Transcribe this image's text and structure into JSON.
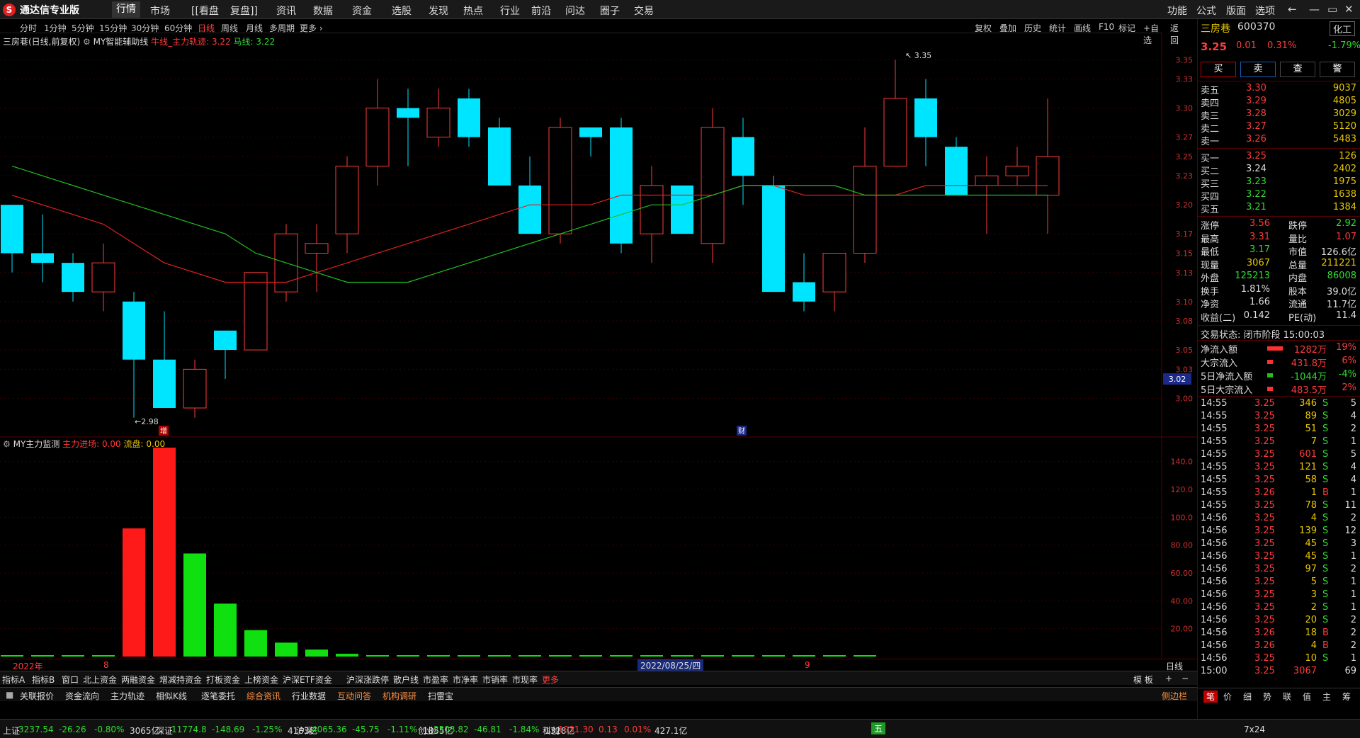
{
  "app": {
    "name": "通达信专业版"
  },
  "topmenu": [
    "行情",
    "市场",
    "[[看盘",
    "复盘]]",
    "资讯",
    "数据",
    "资金",
    "选股",
    "发现",
    "热点",
    "行业",
    "前沿",
    "问达",
    "圈子",
    "交易"
  ],
  "topmenu_right": [
    "功能",
    "公式",
    "版面",
    "选项"
  ],
  "periods": [
    "分时",
    "1分钟",
    "5分钟",
    "15分钟",
    "30分钟",
    "60分钟",
    "日线",
    "周线",
    "月线",
    "多周期",
    "更多 ›"
  ],
  "tools": [
    "复权",
    "叠加",
    "历史",
    "统计",
    "画线",
    "F10",
    "标记",
    "+自选",
    "返回"
  ],
  "main_title": {
    "stock": "三房巷(日线,前复权)",
    "indicator": "MY智能辅助线",
    "l1": "牛线_主力轨迹: 3.22",
    "l2": "马线: 3.22"
  },
  "sub_title": {
    "name": "MY主力监测",
    "l1": "主力进场: 0.00",
    "l2": "流盘: 0.00"
  },
  "price_axis": [
    "3.35",
    "3.33",
    "3.30",
    "3.27",
    "3.25",
    "3.23",
    "3.20",
    "3.17",
    "3.15",
    "3.13",
    "3.10",
    "3.08",
    "3.05",
    "3.03",
    "3.00"
  ],
  "price_marker": "3.02",
  "sub_axis": [
    "140.0",
    "120.0",
    "100.0",
    "80.00",
    "60.00",
    "40.00",
    "20.00"
  ],
  "annotations": {
    "high": "3.35",
    "low": "2.98",
    "zeng": "增",
    "cai": "财"
  },
  "chart_data": {
    "type": "candlestick",
    "candles": [
      {
        "o": 3.2,
        "h": 3.2,
        "l": 3.13,
        "c": 3.15
      },
      {
        "o": 3.15,
        "h": 3.19,
        "l": 3.12,
        "c": 3.14
      },
      {
        "o": 3.14,
        "h": 3.15,
        "l": 3.1,
        "c": 3.11
      },
      {
        "o": 3.11,
        "h": 3.16,
        "l": 3.09,
        "c": 3.14
      },
      {
        "o": 3.1,
        "h": 3.11,
        "l": 2.98,
        "c": 3.04
      },
      {
        "o": 3.04,
        "h": 3.09,
        "l": 2.99,
        "c": 2.99
      },
      {
        "o": 2.99,
        "h": 3.04,
        "l": 2.98,
        "c": 3.03
      },
      {
        "o": 3.07,
        "h": 3.07,
        "l": 3.02,
        "c": 3.05
      },
      {
        "o": 3.05,
        "h": 3.13,
        "l": 3.05,
        "c": 3.13
      },
      {
        "o": 3.11,
        "h": 3.18,
        "l": 3.1,
        "c": 3.17
      },
      {
        "o": 3.15,
        "h": 3.18,
        "l": 3.11,
        "c": 3.16
      },
      {
        "o": 3.17,
        "h": 3.25,
        "l": 3.15,
        "c": 3.24
      },
      {
        "o": 3.24,
        "h": 3.33,
        "l": 3.22,
        "c": 3.3
      },
      {
        "o": 3.3,
        "h": 3.32,
        "l": 3.24,
        "c": 3.29
      },
      {
        "o": 3.27,
        "h": 3.32,
        "l": 3.26,
        "c": 3.3
      },
      {
        "o": 3.31,
        "h": 3.32,
        "l": 3.26,
        "c": 3.27
      },
      {
        "o": 3.28,
        "h": 3.29,
        "l": 3.22,
        "c": 3.22
      },
      {
        "o": 3.22,
        "h": 3.25,
        "l": 3.17,
        "c": 3.17
      },
      {
        "o": 3.17,
        "h": 3.29,
        "l": 3.16,
        "c": 3.28
      },
      {
        "o": 3.28,
        "h": 3.28,
        "l": 3.25,
        "c": 3.27
      },
      {
        "o": 3.28,
        "h": 3.29,
        "l": 3.15,
        "c": 3.16
      },
      {
        "o": 3.17,
        "h": 3.24,
        "l": 3.14,
        "c": 3.22
      },
      {
        "o": 3.22,
        "h": 3.22,
        "l": 3.17,
        "c": 3.17
      },
      {
        "o": 3.16,
        "h": 3.3,
        "l": 3.14,
        "c": 3.28
      },
      {
        "o": 3.27,
        "h": 3.29,
        "l": 3.2,
        "c": 3.23
      },
      {
        "o": 3.22,
        "h": 3.23,
        "l": 3.11,
        "c": 3.11
      },
      {
        "o": 3.12,
        "h": 3.15,
        "l": 3.09,
        "c": 3.1
      },
      {
        "o": 3.11,
        "h": 3.15,
        "l": 3.09,
        "c": 3.15
      },
      {
        "o": 3.15,
        "h": 3.28,
        "l": 3.14,
        "c": 3.24
      },
      {
        "o": 3.24,
        "h": 3.35,
        "l": 3.24,
        "c": 3.31
      },
      {
        "o": 3.31,
        "h": 3.33,
        "l": 3.24,
        "c": 3.27
      },
      {
        "o": 3.26,
        "h": 3.27,
        "l": 3.22,
        "c": 3.21
      },
      {
        "o": 3.22,
        "h": 3.25,
        "l": 3.17,
        "c": 3.23
      },
      {
        "o": 3.23,
        "h": 3.26,
        "l": 3.22,
        "c": 3.24
      },
      {
        "o": 3.21,
        "h": 3.31,
        "l": 3.17,
        "c": 3.25
      }
    ],
    "ma_red": [
      3.21,
      3.2,
      3.19,
      3.18,
      3.16,
      3.14,
      3.13,
      3.12,
      3.12,
      3.12,
      3.13,
      3.14,
      3.15,
      3.16,
      3.17,
      3.18,
      3.19,
      3.2,
      3.2,
      3.2,
      3.21,
      3.21,
      3.21,
      3.21,
      3.22,
      3.22,
      3.21,
      3.21,
      3.21,
      3.21,
      3.22,
      3.22,
      3.22,
      3.22,
      3.22
    ],
    "ma_green": [
      3.24,
      3.23,
      3.22,
      3.21,
      3.2,
      3.19,
      3.18,
      3.17,
      3.15,
      3.14,
      3.13,
      3.12,
      3.12,
      3.12,
      3.13,
      3.14,
      3.15,
      3.16,
      3.17,
      3.18,
      3.19,
      3.2,
      3.2,
      3.21,
      3.22,
      3.22,
      3.22,
      3.22,
      3.21,
      3.21,
      3.21,
      3.21,
      3.21,
      3.21,
      3.21
    ],
    "bars": [
      0,
      0,
      0,
      0,
      92,
      150,
      74,
      38,
      19,
      10,
      5,
      2,
      1,
      0.5,
      0.5,
      0.5,
      0.5,
      0.5,
      0.5,
      0.5,
      0.5,
      0.5,
      0.5,
      0.5,
      0.5,
      0.5,
      0.5,
      0.5,
      0.5
    ],
    "bar_colors": [
      "g",
      "g",
      "g",
      "g",
      "r",
      "r",
      "g",
      "g",
      "g",
      "g",
      "g",
      "g",
      "g",
      "g",
      "g",
      "g",
      "g",
      "g",
      "g",
      "g",
      "g",
      "g",
      "g",
      "g",
      "g",
      "g",
      "g",
      "g",
      "g"
    ],
    "ylim_price": [
      2.96,
      3.37
    ],
    "ylim_sub": [
      0,
      150
    ]
  },
  "dates": {
    "y": "2022年",
    "m8": "8",
    "cursor": "2022/08/25/四",
    "m9": "9",
    "period": "日线"
  },
  "tabs1": [
    "指标A",
    "指标B",
    "窗口",
    "北上资金",
    "两融资金",
    "增减持资金",
    "打板资金",
    "上榜资金",
    "沪深ETF资金",
    "沪深涨跌停",
    "散户线",
    "市盈率",
    "市净率",
    "市销率",
    "市现率",
    "更多"
  ],
  "tabs1_right": [
    "模 板",
    "+",
    "−"
  ],
  "tabs2": [
    "关联报价",
    "资金流向",
    "主力轨迹",
    "相似K线",
    "逐笔委托",
    "综合资讯",
    "行业数据",
    "互动问答",
    "机构调研",
    "扫雷宝"
  ],
  "tabs2_right": "侧边栏",
  "status": {
    "sh": [
      "上证",
      "3237.54",
      "-26.26",
      "-0.80%",
      "3065亿"
    ],
    "sz": [
      "深证",
      "11774.8",
      "-148.69",
      "-1.25%",
      "4163亿"
    ],
    "hs": [
      "沪深",
      "4065.36",
      "-45.75",
      "-1.11%",
      "1855亿"
    ],
    "cy": [
      "创业",
      "2503.82",
      "-46.81",
      "-1.84%",
      "1328亿"
    ],
    "kc": [
      "科创",
      "1031.30",
      "0.13",
      "0.01%",
      "427.1亿"
    ],
    "ime": "五",
    "time": "7x24"
  },
  "quote": {
    "name": "三房巷",
    "code": "600370",
    "sector": "化工",
    "sector_chg": "-1.79%",
    "price": "3.25",
    "chg": "0.01",
    "pct": "0.31%",
    "buttons": [
      "买",
      "卖",
      "查",
      "警"
    ],
    "asks": [
      [
        "卖五",
        "3.30",
        "9037"
      ],
      [
        "卖四",
        "3.29",
        "4805"
      ],
      [
        "卖三",
        "3.28",
        "3029"
      ],
      [
        "卖二",
        "3.27",
        "5120"
      ],
      [
        "卖一",
        "3.26",
        "5483"
      ]
    ],
    "bids": [
      [
        "买一",
        "3.25",
        "126"
      ],
      [
        "买二",
        "3.24",
        "2402"
      ],
      [
        "买三",
        "3.23",
        "1975"
      ],
      [
        "买四",
        "3.22",
        "1638"
      ],
      [
        "买五",
        "3.21",
        "1384"
      ]
    ],
    "stats": [
      [
        "涨停",
        "3.56",
        "跌停",
        "2.92"
      ],
      [
        "最高",
        "3.31",
        "量比",
        "1.07"
      ],
      [
        "最低",
        "3.17",
        "市值",
        "126.6亿"
      ],
      [
        "现量",
        "3067",
        "总量",
        "211221"
      ],
      [
        "外盘",
        "125213",
        "内盘",
        "86008"
      ],
      [
        "换手",
        "1.81%",
        "股本",
        "39.0亿"
      ],
      [
        "净资",
        "1.66",
        "流通",
        "11.7亿"
      ],
      [
        "收益(二)",
        "0.142",
        "PE(动)",
        "11.4"
      ]
    ],
    "trade_state": "交易状态: 闭市阶段 15:00:03",
    "flows": [
      [
        "净流入额",
        "1282万",
        "19%"
      ],
      [
        "大宗流入",
        "431.8万",
        "6%"
      ],
      [
        "5日净流入额",
        "-1044万",
        "-4%"
      ],
      [
        "5日大宗流入",
        "483.5万",
        "2%"
      ]
    ],
    "ticks": [
      [
        "14:55",
        "3.25",
        "346",
        "S",
        "5"
      ],
      [
        "14:55",
        "3.25",
        "89",
        "S",
        "4"
      ],
      [
        "14:55",
        "3.25",
        "51",
        "S",
        "2"
      ],
      [
        "14:55",
        "3.25",
        "7",
        "S",
        "1"
      ],
      [
        "14:55",
        "3.25",
        "601",
        "S",
        "5"
      ],
      [
        "14:55",
        "3.25",
        "121",
        "S",
        "4"
      ],
      [
        "14:55",
        "3.25",
        "58",
        "S",
        "4"
      ],
      [
        "14:55",
        "3.26",
        "1",
        "B",
        "1"
      ],
      [
        "14:55",
        "3.25",
        "78",
        "S",
        "11"
      ],
      [
        "14:56",
        "3.25",
        "4",
        "S",
        "2"
      ],
      [
        "14:56",
        "3.25",
        "139",
        "S",
        "12"
      ],
      [
        "14:56",
        "3.25",
        "45",
        "S",
        "3"
      ],
      [
        "14:56",
        "3.25",
        "45",
        "S",
        "1"
      ],
      [
        "14:56",
        "3.25",
        "97",
        "S",
        "2"
      ],
      [
        "14:56",
        "3.25",
        "5",
        "S",
        "1"
      ],
      [
        "14:56",
        "3.25",
        "3",
        "S",
        "1"
      ],
      [
        "14:56",
        "3.25",
        "2",
        "S",
        "1"
      ],
      [
        "14:56",
        "3.25",
        "20",
        "S",
        "2"
      ],
      [
        "14:56",
        "3.26",
        "18",
        "B",
        "2"
      ],
      [
        "14:56",
        "3.26",
        "4",
        "B",
        "2"
      ],
      [
        "14:56",
        "3.25",
        "10",
        "S",
        "1"
      ],
      [
        "15:00",
        "3.25",
        "3067",
        "",
        "69"
      ]
    ],
    "bottom_tabs": [
      "笔",
      "价",
      "细",
      "势",
      "联",
      "值",
      "主",
      "筹"
    ]
  }
}
